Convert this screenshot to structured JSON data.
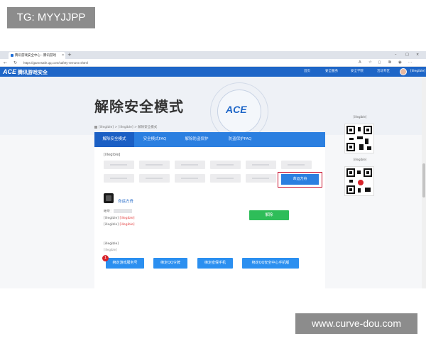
{
  "watermarks": {
    "top_left": "TG: MYYJJPP",
    "bottom_right": "www.curve-dou.com"
  },
  "browser": {
    "tab_title": "腾讯游戏安全中心 - 腾讯游戏",
    "new_tab_glyph": "+",
    "url": "https://gamesafe.qq.com/safety-remove.shtml",
    "window_controls": [
      "–",
      "□",
      "×"
    ]
  },
  "site": {
    "logo_ace": "ACE",
    "logo_text": "腾讯游戏安全",
    "nav": [
      "首页",
      "安全服务",
      "安全学院",
      "活动专区"
    ],
    "active_nav_index": 1,
    "user_name": "[illegible]"
  },
  "hero": {
    "title": "解除安全模式",
    "emblem": "ACE"
  },
  "breadcrumb": "[illegible] > [illegible] > 解除安全模式",
  "tabs": [
    "解除安全模式",
    "安全模式FAQ",
    "解除防盗保护",
    "防盗保护FAQ"
  ],
  "active_tab_index": 0,
  "content": {
    "section_label": "[illegible]",
    "selected_game": "命运方舟",
    "account_label": "帐号：",
    "status_label": "[illegible]",
    "status_value": "[illegible]",
    "unlock_method_label": "[illegible]",
    "unlock_method_value": "[illegible]",
    "unlock_button": "解除",
    "notice_text": "[illegible]",
    "notice_small": "[illegible]",
    "badge": "1",
    "bind_buttons": [
      "绑定游戏服务号",
      "绑定QQ令牌",
      "绑定密保手机",
      "绑定QQ安全中心手机版"
    ]
  },
  "sidebar": {
    "qr_caption_1": "[illegible]",
    "qr_caption_2": "[illegible]"
  },
  "colors": {
    "brand_blue": "#1e66c7",
    "tab_blue": "#2b7fe0",
    "green": "#2ebd59",
    "red_highlight": "#c8102e"
  }
}
